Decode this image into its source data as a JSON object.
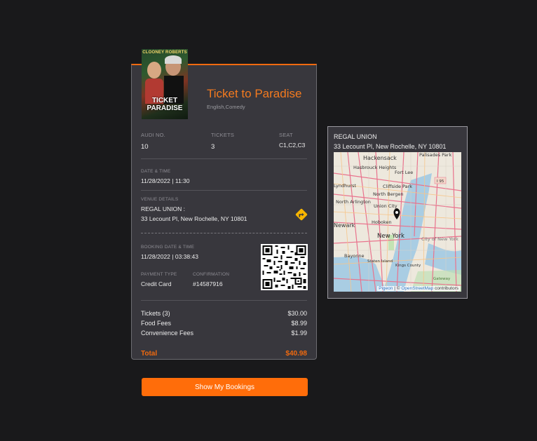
{
  "movie": {
    "title": "Ticket to Paradise",
    "genre": "English,Comedy",
    "poster_top": "CLOONEY ROBERTS",
    "poster_title_line1": "TICKET",
    "poster_title_line2": "PARADISE"
  },
  "booking": {
    "audi_label": "AUDI NO.",
    "audi_value": "10",
    "tickets_label": "TICKETS",
    "tickets_value": "3",
    "seat_label": "SEAT",
    "seat_value": "C1,C2,C3",
    "datetime_label": "DATE & TIME",
    "datetime_value": "11/28/2022 | 11:30",
    "venue_label": "VENUE DETAILS",
    "venue_name": "REGAL UNION :",
    "venue_address": "33 Lecount Pl, New Rochelle, NY 10801",
    "booking_dt_label": "BOOKING DATE & TIME",
    "booking_dt_value": "11/28/2022 | 03:38:43",
    "payment_label": "PAYMENT TYPE",
    "payment_value": "Credit Card",
    "confirmation_label": "CONFIRMATION",
    "confirmation_value": "#14587916"
  },
  "prices": {
    "tickets_label": "Tickets (3)",
    "tickets_value": "$30.00",
    "food_label": "Food Fees",
    "food_value": "$8.99",
    "conv_label": "Convenience Fees",
    "conv_value": "$1.99",
    "total_label": "Total",
    "total_value": "$40.98"
  },
  "actions": {
    "show_bookings": "Show My Bookings"
  },
  "venue_card": {
    "name": "REGAL UNION",
    "address": "33 Lecount Pl, New Rochelle, NY 10801"
  },
  "map": {
    "labels": [
      "Palisades Park",
      "Hackensack",
      "Hasbrouck Heights",
      "Fort Lee",
      "Lyndhurst",
      "Cliffside Park",
      "North Bergen",
      "North Arlington",
      "Union City",
      "Newark",
      "Hoboken",
      "New York",
      "Bayonne",
      "Staten Island",
      "City of New York",
      "Kings County",
      "Gateway",
      "I 95"
    ],
    "attribution_pigeon": "Pigeon",
    "attribution_sep": "| ©",
    "attribution_osm": "OpenStreetMap",
    "attribution_tail": "contributors"
  },
  "colors": {
    "accent": "#ff6d0a",
    "card": "#38373d",
    "background": "#19191b"
  }
}
